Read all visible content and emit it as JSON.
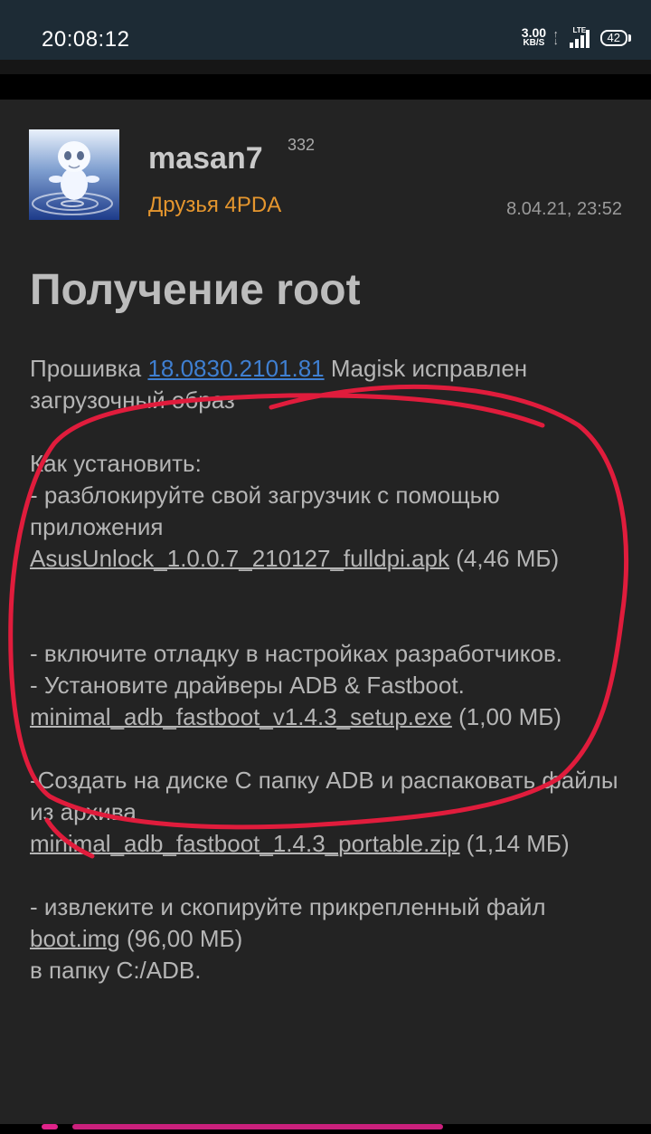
{
  "status_bar": {
    "time": "20:08:12",
    "speed_value": "3.00",
    "speed_unit": "KB/S",
    "network": "LTE",
    "battery": "42"
  },
  "post": {
    "username": "masan7",
    "reputation": "332",
    "group": "Друзья 4PDA",
    "date": "8.04.21, 23:52",
    "title": "Получение root",
    "firmware_prefix": "Прошивка ",
    "firmware_link": "18.0830.2101.81",
    "firmware_suffix": " Magisk исправлен загрузочный образ",
    "howto_label": "Как установить:",
    "step1_text": "- разблокируйте свой загрузчик с помощью приложения",
    "step1_file": "AsusUnlock_1.0.0.7_210127_fulldpi.apk",
    "step1_size": " (4,46 МБ)",
    "step2_text": "- включите отладку в настройках разработчиков.",
    "step3_text": "- Установите драйверы ADB & Fastboot.",
    "step3_file": "minimal_adb_fastboot_v1.4.3_setup.exe",
    "step3_size": " (1,00 МБ)",
    "step4_text": "-Создать на диске С папку ADB и распаковать файлы из архива",
    "step4_file": "minimal_adb_fastboot_1.4.3_portable.zip",
    "step4_size": " (1,14 МБ)",
    "step5_text": "- извлеките и скопируйте прикрепленный файл ",
    "step5_file": "boot.img",
    "step5_size": " (96,00 МБ)",
    "step5_end": "в папку C:/ADB."
  },
  "annotation_color": "#e01c3c",
  "accent_colors": {
    "link": "#3f7fd1",
    "group": "#e5962e",
    "pink": "#e0238a"
  }
}
